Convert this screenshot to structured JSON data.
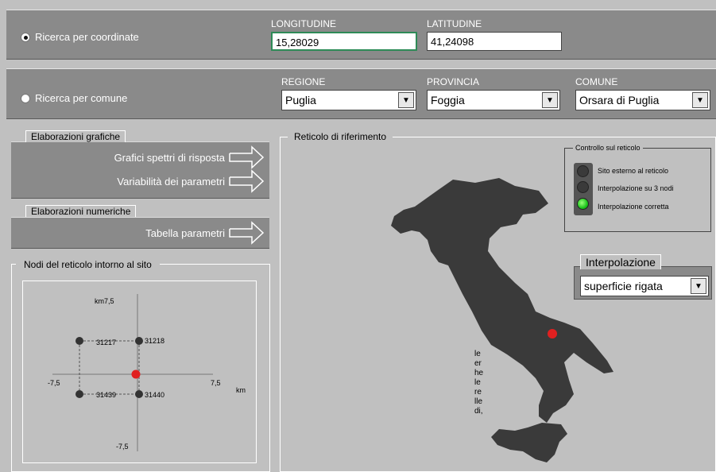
{
  "coords": {
    "radio_label": "Ricerca per coordinate",
    "longitude_label": "LONGITUDINE",
    "longitude_value": "15,28029",
    "latitude_label": "LATITUDINE",
    "latitude_value": "41,24098"
  },
  "comune": {
    "radio_label": "Ricerca per comune",
    "regione_label": "REGIONE",
    "regione_value": "Puglia",
    "provincia_label": "PROVINCIA",
    "provincia_value": "Foggia",
    "comune_label": "COMUNE",
    "comune_value": "Orsara di Puglia"
  },
  "grafiche": {
    "title": "Elaborazioni grafiche",
    "btn1": "Grafici spettri di risposta",
    "btn2": "Variabilità dei parametri"
  },
  "numeriche": {
    "title": "Elaborazioni numeriche",
    "btn1": "Tabella parametri"
  },
  "nodi": {
    "title": "Nodi del reticolo intorno al sito",
    "y_top": "7,5",
    "km_top": "km",
    "x_left": "-7,5",
    "x_right": "7,5",
    "km_right": "km",
    "y_bottom": "-7,5",
    "node_tl": "31217",
    "node_tr": "31218",
    "node_bl": "31439",
    "node_br": "31440"
  },
  "reticolo": {
    "title": "Reticolo di riferimento",
    "controllo_title": "Controllo sul reticolo",
    "status1": "Sito esterno al reticolo",
    "status2": "Interpolazione su 3 nodi",
    "status3": "Interpolazione corretta",
    "interp_title": "Interpolazione",
    "interp_value": "superficie rigata",
    "partial_text": [
      "le",
      "er",
      "he",
      "le",
      "re",
      "lle",
      "di,"
    ]
  },
  "colors": {
    "site_marker": "#e02020",
    "active_led": "#1cc41c",
    "panel_gray": "#8a8a8a",
    "bg": "#c0c0c0"
  },
  "icons": {
    "dropdown": "chevron-down-icon",
    "go": "arrow-right-icon"
  }
}
